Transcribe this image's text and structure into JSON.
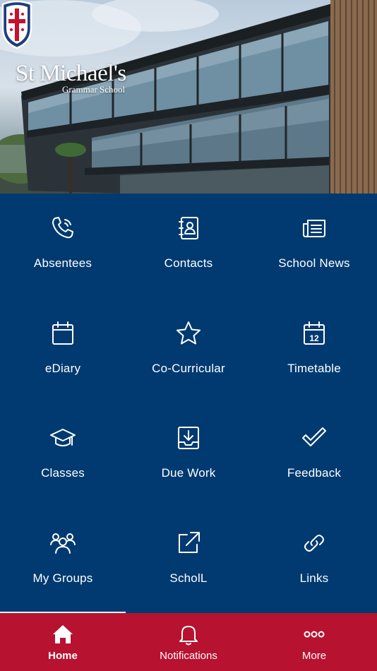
{
  "hero": {
    "logo_name": "St Michael's",
    "logo_sub": "Grammar School",
    "logo_icon": "school-crest"
  },
  "grid": {
    "tiles": [
      {
        "label": "Absentees",
        "icon": "phone-icon"
      },
      {
        "label": "Contacts",
        "icon": "contact-book-icon"
      },
      {
        "label": "School News",
        "icon": "newspaper-icon"
      },
      {
        "label": "eDiary",
        "icon": "calendar-icon"
      },
      {
        "label": "Co-Curricular",
        "icon": "star-icon"
      },
      {
        "label": "Timetable",
        "icon": "calendar-12-icon"
      },
      {
        "label": "Classes",
        "icon": "graduation-cap-icon"
      },
      {
        "label": "Due Work",
        "icon": "download-tray-icon"
      },
      {
        "label": "Feedback",
        "icon": "checkmark-icon"
      },
      {
        "label": "My Groups",
        "icon": "group-icon"
      },
      {
        "label": "ScholL",
        "icon": "external-link-icon"
      },
      {
        "label": "Links",
        "icon": "link-icon"
      }
    ],
    "calendar_day": "12"
  },
  "tabbar": {
    "tabs": [
      {
        "label": "Home",
        "icon": "home-icon",
        "active": true
      },
      {
        "label": "Notifications",
        "icon": "bell-icon",
        "active": false
      },
      {
        "label": "More",
        "icon": "more-dots-icon",
        "active": false
      }
    ]
  },
  "colors": {
    "grid_background": "#003a70",
    "tabbar_background": "#b7122f",
    "text": "#ffffff"
  }
}
